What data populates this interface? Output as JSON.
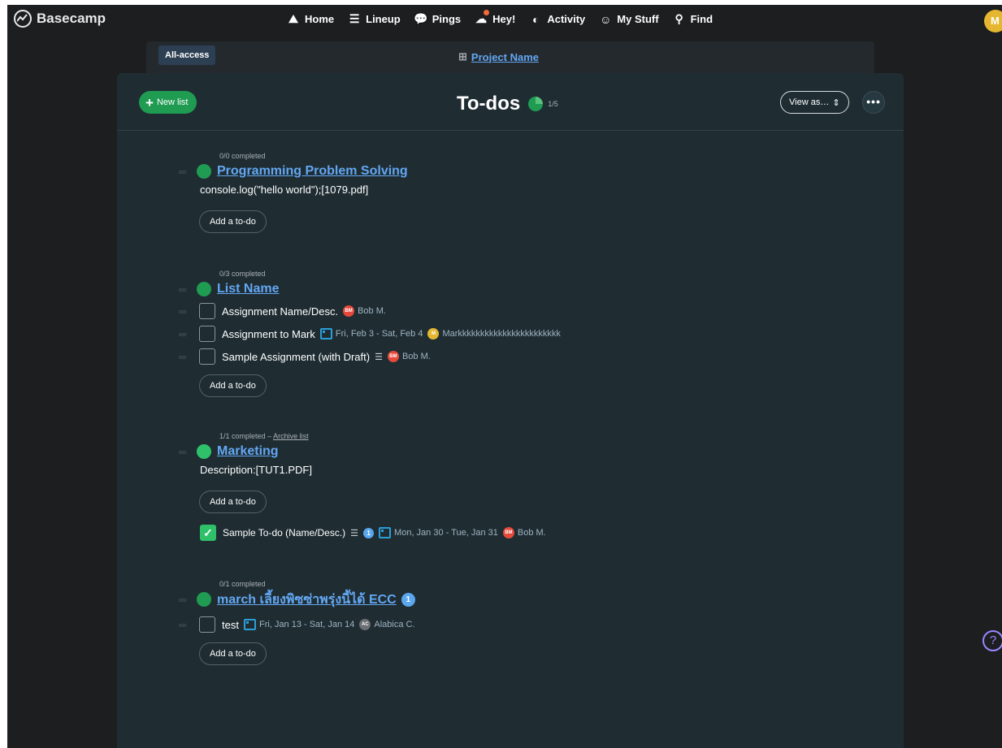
{
  "nav": {
    "logo": "Basecamp",
    "items": [
      {
        "label": "Home",
        "icon": "home-icon",
        "glyph": "⛰"
      },
      {
        "label": "Lineup",
        "icon": "lineup-icon",
        "glyph": "☰"
      },
      {
        "label": "Pings",
        "icon": "pings-icon",
        "glyph": "💬"
      },
      {
        "label": "Hey!",
        "icon": "hey-icon",
        "glyph": "☁"
      },
      {
        "label": "Activity",
        "icon": "activity-icon",
        "glyph": "◐"
      },
      {
        "label": "My Stuff",
        "icon": "mystuff-icon",
        "glyph": "☺"
      },
      {
        "label": "Find",
        "icon": "search-icon",
        "glyph": "⚲"
      }
    ],
    "me_initial": "M"
  },
  "project": {
    "badge": "All-access",
    "name": "Project Name"
  },
  "header": {
    "new_list": "New list",
    "title": "To-dos",
    "progress": "1/5",
    "view_as": "View as…",
    "more": "•••"
  },
  "lists": [
    {
      "meta": "0/0 completed",
      "title": "Programming Problem Solving",
      "description": "console.log(\"hello world\");[1079.pdf]",
      "add": "Add a to-do"
    },
    {
      "meta": "0/3 completed",
      "title": "List Name",
      "todos": [
        {
          "title": "Assignment Name/Desc.",
          "avatar": "BM",
          "person": "Bob M."
        },
        {
          "title": "Assignment to Mark",
          "date": "Fri, Feb 3 - Sat, Feb 4",
          "avatar": "M",
          "person": "Markkkkkkkkkkkkkkkkkkkkkkk"
        },
        {
          "title": "Sample Assignment (with Draft)",
          "avatar": "BM",
          "person": "Bob M."
        }
      ],
      "add": "Add a to-do"
    },
    {
      "meta": "1/1 completed –",
      "archive": "Archive list",
      "title": "Marketing",
      "description": "Description:[TUT1.PDF]",
      "add": "Add a to-do",
      "completed": {
        "title": "Sample To-do (Name/Desc.)",
        "comments": "1",
        "date": "Mon, Jan 30 - Tue, Jan 31",
        "avatar": "BM",
        "person": "Bob M."
      }
    },
    {
      "meta": "0/1 completed",
      "title": "march เลี้ยงพิซซ่าพรุ่งนี้ได้ ECC",
      "badge": "1",
      "todos": [
        {
          "title": "test",
          "date": "Fri, Jan 13 - Sat, Jan 14",
          "avatar": "AC",
          "person": "Alabica C."
        }
      ],
      "add": "Add a to-do"
    }
  ],
  "help": "?"
}
